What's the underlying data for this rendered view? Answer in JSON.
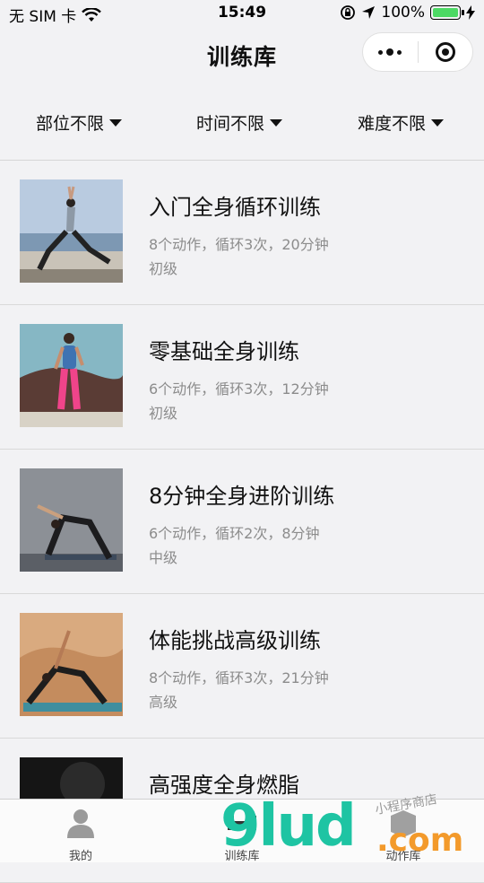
{
  "status_bar": {
    "carrier": "无 SIM 卡",
    "time": "15:49",
    "battery": "100%",
    "battery_level": 1.0
  },
  "nav": {
    "title": "训练库"
  },
  "filters": [
    {
      "label": "部位不限"
    },
    {
      "label": "时间不限"
    },
    {
      "label": "难度不限"
    }
  ],
  "workouts": [
    {
      "title": "入门全身循环训练",
      "meta": "8个动作，循环3次，20分钟",
      "level": "初级"
    },
    {
      "title": "零基础全身训练",
      "meta": "6个动作，循环3次，12分钟",
      "level": "初级"
    },
    {
      "title": "8分钟全身进阶训练",
      "meta": "6个动作，循环2次，8分钟",
      "level": "中级"
    },
    {
      "title": "体能挑战高级训练",
      "meta": "8个动作，循环3次，21分钟",
      "level": "高级"
    },
    {
      "title": "高强度全身燃脂",
      "meta": "",
      "level": ""
    }
  ],
  "tabs": [
    {
      "label": "我的",
      "icon": "person-icon"
    },
    {
      "label": "训练库",
      "icon": "dumbbell-icon"
    },
    {
      "label": "动作库",
      "icon": "box-icon"
    }
  ],
  "watermark": {
    "main": "9lud",
    "com": ".com",
    "sub": "小程序商店"
  },
  "colors": {
    "background": "#f2f2f4",
    "battery": "#4cd964",
    "watermark_green": "#1ec4a3",
    "watermark_orange": "#f39a2b"
  }
}
